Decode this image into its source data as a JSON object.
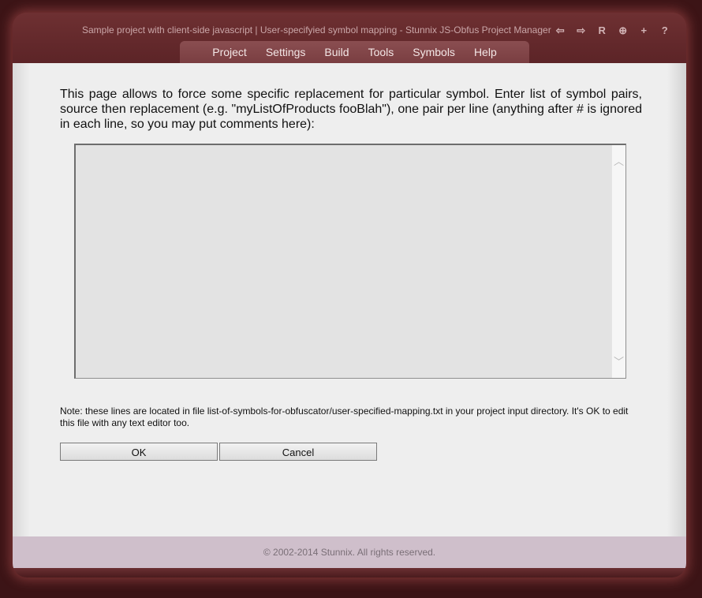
{
  "window": {
    "title": "Sample project with client-side javascript | User-specifyied symbol mapping - Stunnix JS-Obfus Project Manager",
    "controls": [
      {
        "name": "back-icon",
        "glyph": "⇦"
      },
      {
        "name": "forward-icon",
        "glyph": "⇨"
      },
      {
        "name": "reload-icon",
        "glyph": "R"
      },
      {
        "name": "zoom-in-icon",
        "glyph": "⊕"
      },
      {
        "name": "plus-icon",
        "glyph": "+"
      },
      {
        "name": "help-icon",
        "glyph": "?"
      }
    ]
  },
  "menu": {
    "items": [
      "Project",
      "Settings",
      "Build",
      "Tools",
      "Symbols",
      "Help"
    ]
  },
  "main": {
    "intro": "This page allows to force some specific replacement for particular symbol. Enter list of symbol pairs, source then replacement (e.g. \"myListOfProducts fooBlah\"), one pair per line (anything after # is ignored in each line, so you may put comments here):",
    "mapping_value": "",
    "note": "Note: these lines are located in file list-of-symbols-for-obfuscator/user-specified-mapping.txt in your project input directory. It's OK to edit this file with any text editor too.",
    "ok_label": "OK",
    "cancel_label": "Cancel"
  },
  "footer": {
    "copyright": "© 2002-2014 Stunnix. All rights reserved."
  },
  "colors": {
    "frame": "#5a2124",
    "background": "#3c1416",
    "content": "#eeeeee",
    "footer": "#cfbfcb"
  }
}
